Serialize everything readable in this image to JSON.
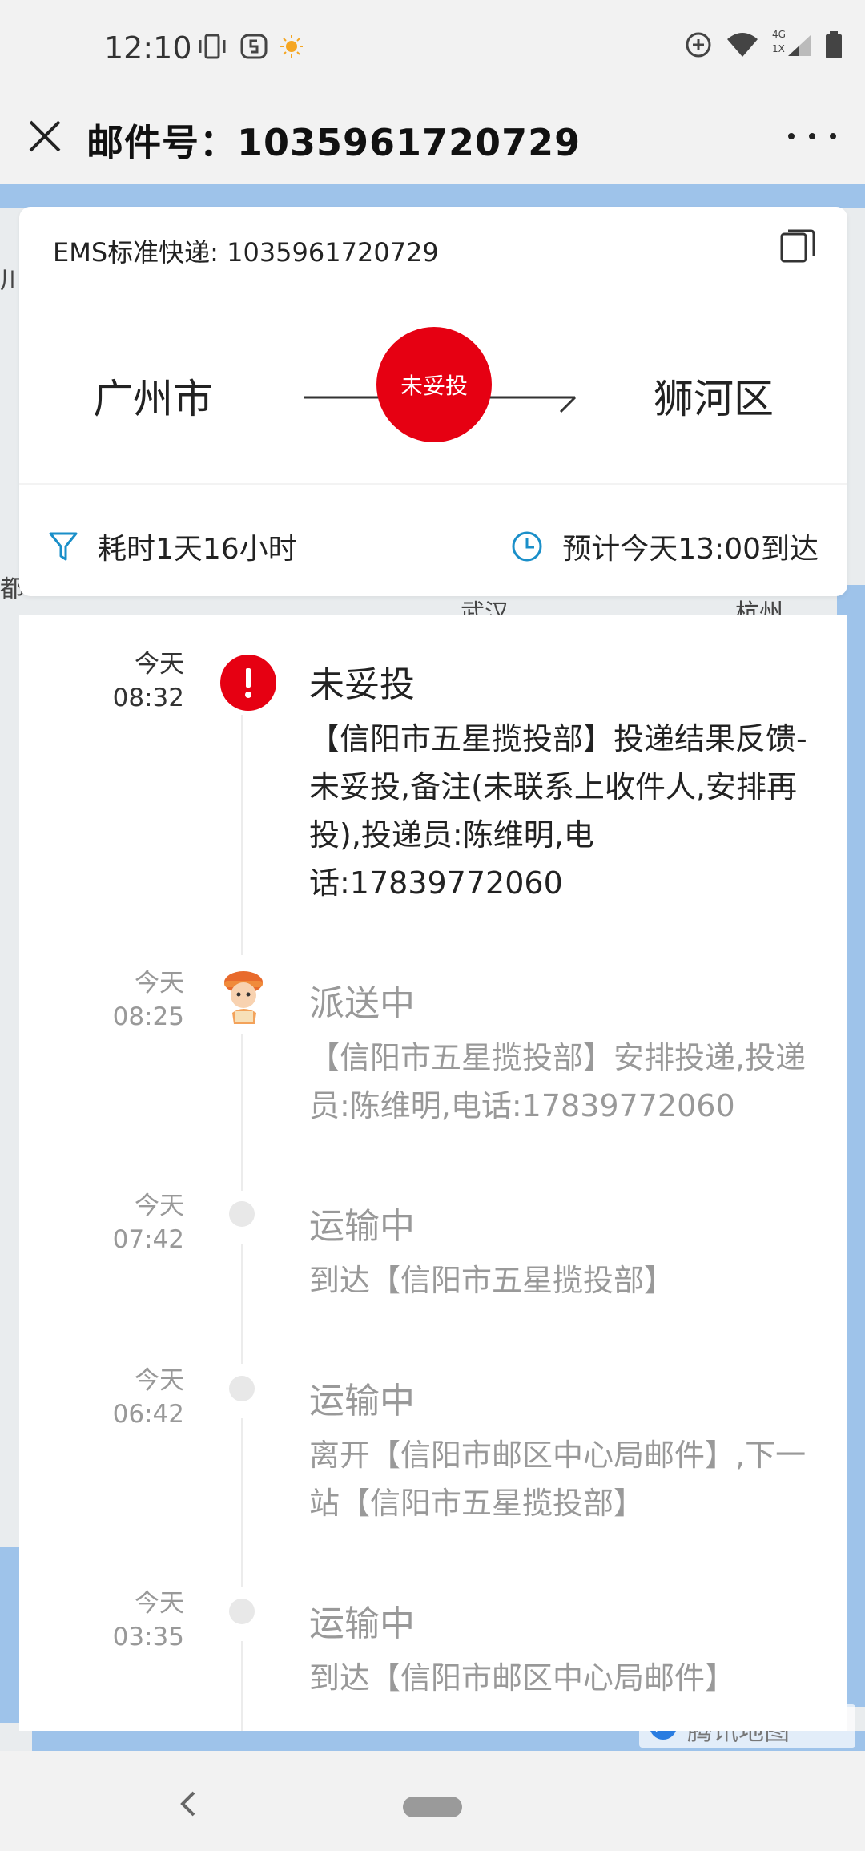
{
  "status_bar": {
    "time": "12:10",
    "icons_left": [
      "vibrate-icon",
      "app-notification-icon",
      "weather-sun-icon"
    ],
    "icons_right": [
      "sync-plus-icon",
      "wifi-icon",
      "signal-icon",
      "battery-icon"
    ],
    "network_labels": [
      "4G",
      "1X"
    ]
  },
  "header": {
    "title": "邮件号：1035961720729",
    "close_icon": "close-icon",
    "more_icon": "more-dots-icon"
  },
  "summary": {
    "service_line": "EMS标准快递: 1035961720729",
    "from_city": "广州市",
    "to_city": "狮河区",
    "status": "未妥投",
    "status_color": "#e60012",
    "elapsed": "耗时1天16小时",
    "eta": "预计今天13:00到达",
    "accent_color": "#1a8fc9"
  },
  "map": {
    "labels": [
      "杭州",
      "武汉",
      "都",
      "川"
    ],
    "brand": "腾讯地图"
  },
  "timeline": [
    {
      "day": "今天",
      "time": "08:32",
      "title": "未妥投",
      "desc": "【信阳市五星揽投部】投递结果反馈-未妥投,备注(未联系上收件人,安排再投),投递员:陈维明,电话:17839772060",
      "icon": "alert-icon",
      "active": true
    },
    {
      "day": "今天",
      "time": "08:25",
      "title": "派送中",
      "desc": "【信阳市五星揽投部】安排投递,投递员:陈维明,电话:17839772060",
      "icon": "courier-avatar-icon",
      "active": false
    },
    {
      "day": "今天",
      "time": "07:42",
      "title": "运输中",
      "desc": "到达【信阳市五星揽投部】",
      "icon": "dot-icon",
      "active": false
    },
    {
      "day": "今天",
      "time": "06:42",
      "title": "运输中",
      "desc": "离开【信阳市邮区中心局邮件】,下一站【信阳市五星揽投部】",
      "icon": "dot-icon",
      "active": false
    },
    {
      "day": "今天",
      "time": "03:35",
      "title": "运输中",
      "desc": "到达【信阳市邮区中心局邮件】",
      "icon": "dot-icon",
      "active": false
    }
  ],
  "nav_bar": {
    "back_icon": "back-chevron-icon",
    "home_icon": "home-pill-icon"
  }
}
